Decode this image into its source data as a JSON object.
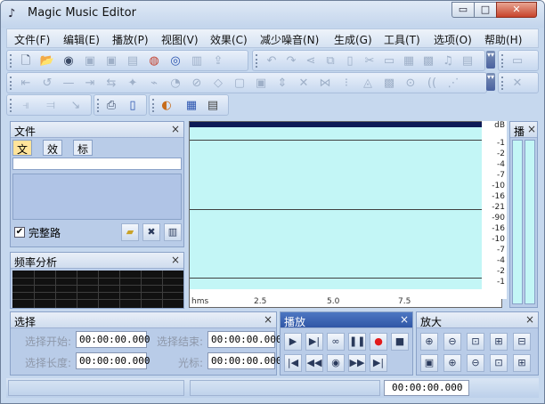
{
  "window": {
    "title": "Magic Music Editor",
    "min_glyph": "▭",
    "max_glyph": "□",
    "close_glyph": "✕"
  },
  "menu": [
    {
      "label": "文件(F)"
    },
    {
      "label": "编辑(E)"
    },
    {
      "label": "播放(P)"
    },
    {
      "label": "视图(V)"
    },
    {
      "label": "效果(C)"
    },
    {
      "label": "减少噪音(N)"
    },
    {
      "label": "生成(G)"
    },
    {
      "label": "工具(T)"
    },
    {
      "label": "选项(O)"
    },
    {
      "label": "帮助(H)"
    }
  ],
  "file_panel": {
    "title": "文件",
    "close": "×",
    "tabs": [
      "文件",
      "效果",
      "标记"
    ],
    "checkbox_label": "完整路",
    "checked": true
  },
  "spectrum_panel": {
    "title": "频率分析",
    "close": "×"
  },
  "waveform": {
    "time_unit": "hms",
    "ticks": [
      "2.5",
      "5.0",
      "7.5"
    ],
    "db_unit": "dB",
    "db_labels": [
      "-1",
      "-2",
      "-4",
      "-7",
      "-10",
      "-16",
      "-21",
      "-90",
      "-16",
      "-10",
      "-7",
      "-4",
      "-2",
      "-1"
    ]
  },
  "meter_panel": {
    "title": "播",
    "close": "×"
  },
  "selection_panel": {
    "title": "选择",
    "close": "×",
    "start_label": "选择开始:",
    "start_value": "00:00:00.000",
    "end_label": "选择结束:",
    "end_value": "00:00:00.000",
    "length_label": "选择长度:",
    "length_value": "00:00:00.000",
    "cursor_label": "光标:",
    "cursor_value": "00:00:00.000"
  },
  "play_panel": {
    "title": "播放",
    "close": "×"
  },
  "zoom_panel": {
    "title": "放大",
    "close": "×"
  },
  "status": {
    "time": "00:00:00.000"
  }
}
